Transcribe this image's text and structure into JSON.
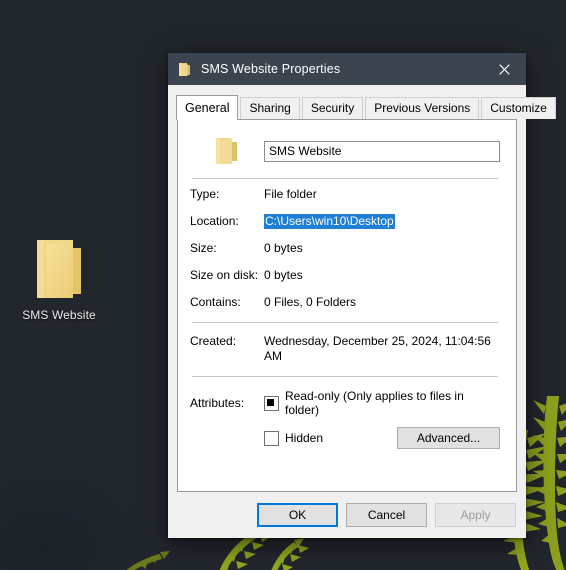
{
  "desktop": {
    "icon": {
      "label": "SMS Website",
      "icon_name": "folder-icon"
    },
    "wallpaper_colors": {
      "background": "#22272e",
      "foliage": "#8fa31e"
    }
  },
  "dialog": {
    "titlebar": {
      "title": "SMS Website Properties",
      "icon_name": "folder-icon",
      "close_label": "✕",
      "background": "#3c4450"
    },
    "tabs": [
      {
        "label": "General",
        "active": true
      },
      {
        "label": "Sharing",
        "active": false
      },
      {
        "label": "Security",
        "active": false
      },
      {
        "label": "Previous Versions",
        "active": false
      },
      {
        "label": "Customize",
        "active": false
      }
    ],
    "general": {
      "name_field": {
        "value": "SMS Website",
        "placeholder": ""
      },
      "properties": [
        {
          "label": "Type:",
          "value": "File folder",
          "selected": false
        },
        {
          "label": "Location:",
          "value": "C:\\Users\\win10\\Desktop",
          "selected": true
        },
        {
          "label": "Size:",
          "value": "0 bytes",
          "selected": false
        },
        {
          "label": "Size on disk:",
          "value": "0 bytes",
          "selected": false
        },
        {
          "label": "Contains:",
          "value": "0 Files, 0 Folders",
          "selected": false
        }
      ],
      "created": {
        "label": "Created:",
        "value": "Wednesday, December 25, 2024, 11:04:56 AM"
      },
      "attributes": {
        "label": "Attributes:",
        "readonly": {
          "text": "Read-only (Only applies to files in folder)",
          "state": "indeterminate"
        },
        "hidden": {
          "text": "Hidden",
          "state": "unchecked"
        },
        "advanced_button": "Advanced..."
      }
    },
    "footer": {
      "ok": "OK",
      "cancel": "Cancel",
      "apply": "Apply",
      "apply_disabled": true,
      "focus_color": "#0078d7"
    }
  },
  "selection_color": "#1e7fd4"
}
